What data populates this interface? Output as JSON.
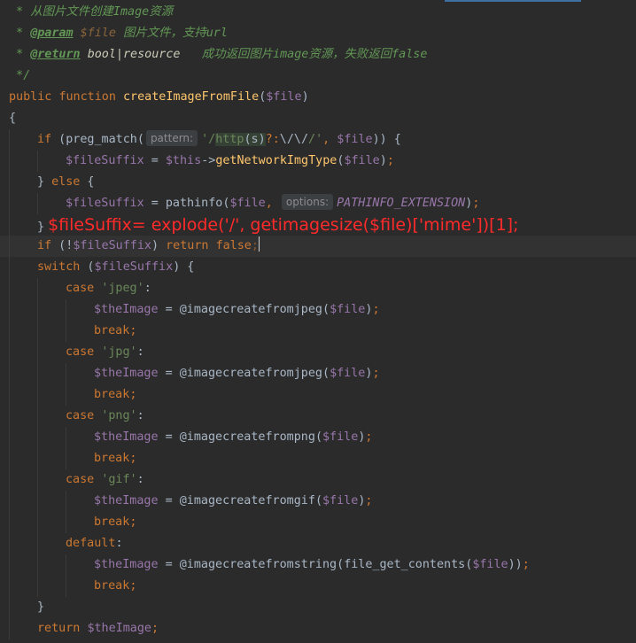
{
  "editor": {
    "language": "php",
    "theme": {
      "background": "#2b2b2b",
      "comment": "#629755",
      "keyword": "#cc7832",
      "function": "#ffc66d",
      "variable": "#9876aa",
      "string": "#6a8759",
      "annotation": "#ff2a2a"
    }
  },
  "doc": {
    "line1_star": " * ",
    "line1_text": "从图片文件创建Image资源",
    "line2_star": " * ",
    "line2_tag": "@param",
    "line2_var": "$file",
    "line2_text": " 图片文件，支持url",
    "line3_star": " * ",
    "line3_tag": "@return",
    "line3_type": "bool|resource",
    "line3_text": "   成功返回图片image资源，失败返回false",
    "line4_close": " */"
  },
  "code": {
    "public": "public",
    "function_kw": "function",
    "fn_name": "createImageFromFile",
    "param": "$file",
    "open_brace": "{",
    "if_kw": "if",
    "preg_match": "preg_match",
    "hint_pattern": "pattern:",
    "regex_q1": "'/",
    "regex_http": "http",
    "regex_s": "(s)",
    "regex_q": "?:",
    "regex_esc": "\\/\\/",
    "regex_end": "/'",
    "var_file": "$file",
    "var_fileSuffix": "$fileSuffix",
    "var_this": "$this",
    "getNetworkImgType": "getNetworkImgType",
    "else_kw": "else",
    "pathinfo": "pathinfo",
    "hint_options": "options:",
    "const_ext": "PATHINFO_EXTENSION",
    "annotation": "$fileSuffix= explode('/', getimagesize($file)['mime'])[1];",
    "return_kw": "return",
    "false_kw": "false",
    "switch_kw": "switch",
    "case_kw": "case",
    "break_kw": "break",
    "default_kw": "default",
    "str_jpeg": "'jpeg'",
    "str_jpg": "'jpg'",
    "str_png": "'png'",
    "str_gif": "'gif'",
    "var_theImage": "$theImage",
    "fn_jpeg": "@imagecreatefromjpeg",
    "fn_png": "@imagecreatefrompng",
    "fn_gif": "@imagecreatefromgif",
    "fn_string": "@imagecreatefromstring",
    "fn_get_contents": "file_get_contents"
  }
}
